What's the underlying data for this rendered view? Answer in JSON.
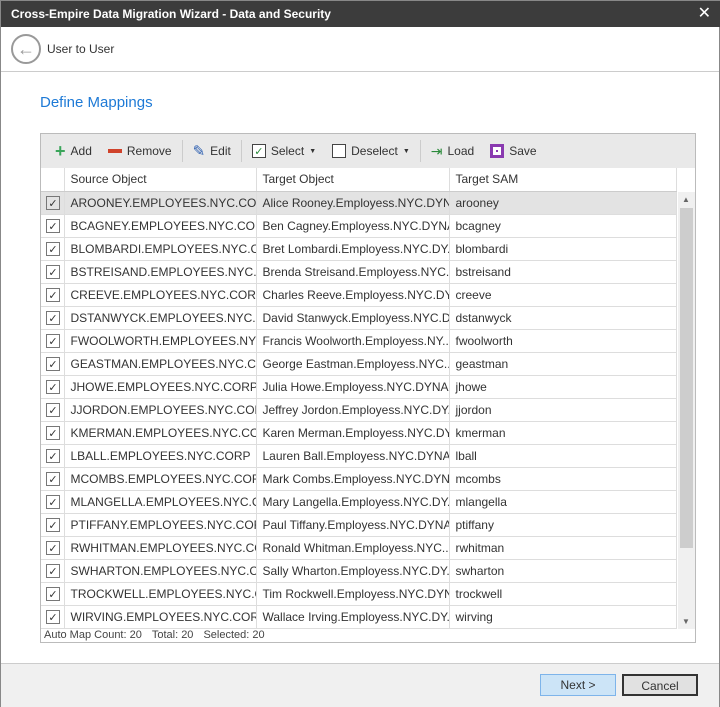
{
  "window": {
    "title": "Cross-Empire Data Migration Wizard  -  Data and Security"
  },
  "nav": {
    "breadcrumb": "User to User"
  },
  "page": {
    "title": "Define Mappings"
  },
  "toolbar": {
    "add": "Add",
    "remove": "Remove",
    "edit": "Edit",
    "select": "Select",
    "deselect": "Deselect",
    "load": "Load",
    "save": "Save"
  },
  "columns": [
    "Source Object",
    "Target Object",
    "Target SAM"
  ],
  "rows": [
    [
      "AROONEY.EMPLOYEES.NYC.CORP",
      "Alice Rooney.Employess.NYC.DYN...",
      "arooney"
    ],
    [
      "BCAGNEY.EMPLOYEES.NYC.CORP",
      "Ben Cagney.Employess.NYC.DYNA...",
      "bcagney"
    ],
    [
      "BLOMBARDI.EMPLOYEES.NYC.CORP",
      "Bret Lombardi.Employess.NYC.DY...",
      "blombardi"
    ],
    [
      "BSTREISAND.EMPLOYEES.NYC.CORP",
      "Brenda Streisand.Employess.NYC....",
      "bstreisand"
    ],
    [
      "CREEVE.EMPLOYEES.NYC.CORP",
      "Charles Reeve.Employess.NYC.DY...",
      "creeve"
    ],
    [
      "DSTANWYCK.EMPLOYEES.NYC.CORP",
      "David Stanwyck.Employess.NYC.D...",
      "dstanwyck"
    ],
    [
      "FWOOLWORTH.EMPLOYEES.NYC....",
      "Francis Woolworth.Employess.NY...",
      "fwoolworth"
    ],
    [
      "GEASTMAN.EMPLOYEES.NYC.CORP",
      "George Eastman.Employess.NYC....",
      "geastman"
    ],
    [
      "JHOWE.EMPLOYEES.NYC.CORP",
      "Julia Howe.Employess.NYC.DYNA...",
      "jhowe"
    ],
    [
      "JJORDON.EMPLOYEES.NYC.CORP",
      "Jeffrey Jordon.Employess.NYC.DY...",
      "jjordon"
    ],
    [
      "KMERMAN.EMPLOYEES.NYC.CORP",
      "Karen Merman.Employess.NYC.DY...",
      "kmerman"
    ],
    [
      "LBALL.EMPLOYEES.NYC.CORP",
      "Lauren Ball.Employess.NYC.DYNA...",
      "lball"
    ],
    [
      "MCOMBS.EMPLOYEES.NYC.CORP",
      "Mark Combs.Employess.NYC.DYN...",
      "mcombs"
    ],
    [
      "MLANGELLA.EMPLOYEES.NYC.CORP",
      "Mary Langella.Employess.NYC.DY...",
      "mlangella"
    ],
    [
      "PTIFFANY.EMPLOYEES.NYC.CORP",
      "Paul Tiffany.Employess.NYC.DYNA...",
      "ptiffany"
    ],
    [
      "RWHITMAN.EMPLOYEES.NYC.CORP",
      "Ronald Whitman.Employess.NYC....",
      "rwhitman"
    ],
    [
      "SWHARTON.EMPLOYEES.NYC.CORP",
      "Sally Wharton.Employess.NYC.DY...",
      "swharton"
    ],
    [
      "TROCKWELL.EMPLOYEES.NYC.CORP",
      "Tim Rockwell.Employess.NYC.DYN...",
      "trockwell"
    ],
    [
      "WIRVING.EMPLOYEES.NYC.CORP",
      "Wallace Irving.Employess.NYC.DY...",
      "wirving"
    ]
  ],
  "status": {
    "auto_map": "Auto Map Count:  20",
    "total": "Total:  20",
    "selected": "Selected:  20"
  },
  "footer": {
    "next": "Next >",
    "cancel": "Cancel"
  }
}
